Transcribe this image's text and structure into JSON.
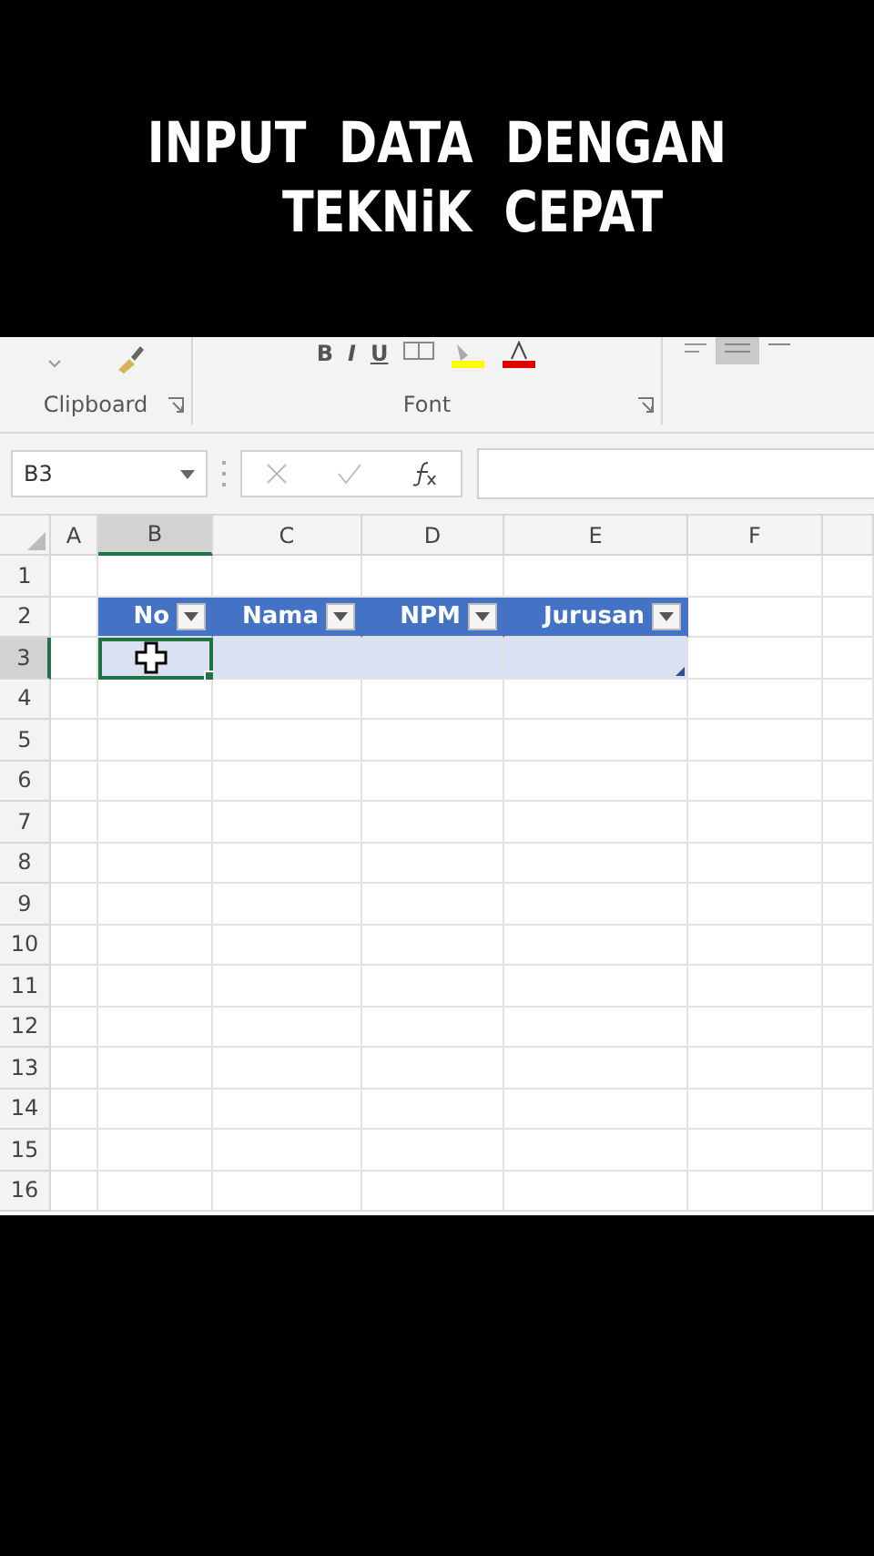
{
  "title": [
    "INPUT  DATA  DENGAN",
    "TEKNiK  CEPAT"
  ],
  "ribbon": {
    "format_buttons": [
      "B",
      "I",
      "U"
    ],
    "groups": [
      {
        "label": "Clipboard"
      },
      {
        "label": "Font"
      }
    ]
  },
  "name_box": "B3",
  "columns": [
    {
      "label": "A",
      "selected": false
    },
    {
      "label": "B",
      "selected": true
    },
    {
      "label": "C",
      "selected": false
    },
    {
      "label": "D",
      "selected": false
    },
    {
      "label": "E",
      "selected": false
    },
    {
      "label": "F",
      "selected": false
    }
  ],
  "rows": [
    {
      "label": "1",
      "selected": false
    },
    {
      "label": "2",
      "selected": false
    },
    {
      "label": "3",
      "selected": true
    },
    {
      "label": "4",
      "selected": false
    },
    {
      "label": "5",
      "selected": false
    },
    {
      "label": "6",
      "selected": false
    },
    {
      "label": "7",
      "selected": false
    },
    {
      "label": "8",
      "selected": false
    },
    {
      "label": "9",
      "selected": false
    },
    {
      "label": "10",
      "selected": false
    },
    {
      "label": "11",
      "selected": false
    },
    {
      "label": "12",
      "selected": false
    },
    {
      "label": "13",
      "selected": false
    },
    {
      "label": "14",
      "selected": false
    },
    {
      "label": "15",
      "selected": false
    },
    {
      "label": "16",
      "selected": false
    }
  ],
  "table": {
    "headers": [
      "No",
      "Nama",
      "NPM",
      "Jurusan"
    ]
  }
}
